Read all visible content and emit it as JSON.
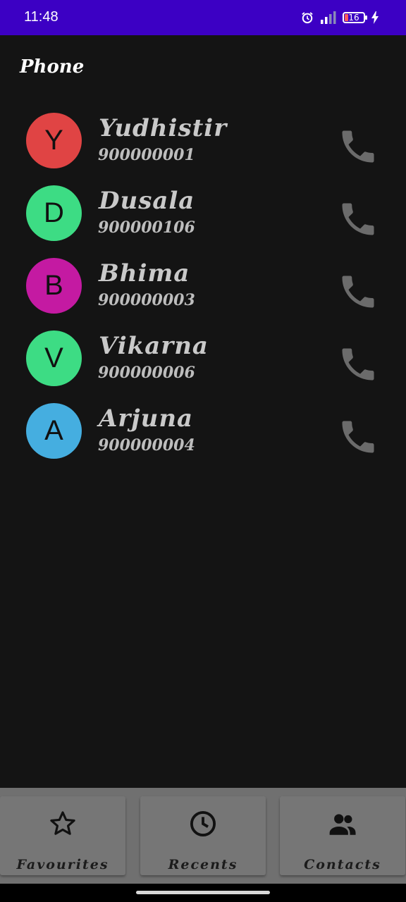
{
  "status_bar": {
    "time": "11:48",
    "battery_level": "16",
    "icons": [
      "alarm-icon",
      "signal-icon",
      "battery-icon",
      "charging-icon"
    ],
    "background_color": "#3c00c4"
  },
  "header": {
    "title": "Phone"
  },
  "contacts": [
    {
      "initial": "Y",
      "name": "Yudhistir",
      "number": "900000001",
      "avatar_color": "#e04444"
    },
    {
      "initial": "D",
      "name": "Dusala",
      "number": "900000106",
      "avatar_color": "#3ddc84"
    },
    {
      "initial": "B",
      "name": "Bhima",
      "number": "900000003",
      "avatar_color": "#c41aa2"
    },
    {
      "initial": "V",
      "name": "Vikarna",
      "number": "900000006",
      "avatar_color": "#3ddc84"
    },
    {
      "initial": "A",
      "name": "Arjuna",
      "number": "900000004",
      "avatar_color": "#45aee0"
    }
  ],
  "bottom_nav": {
    "tabs": [
      {
        "label": "Favourites",
        "icon": "star-icon"
      },
      {
        "label": "Recents",
        "icon": "clock-icon"
      },
      {
        "label": "Contacts",
        "icon": "people-icon"
      }
    ]
  },
  "colors": {
    "background": "#141414",
    "text_primary": "#c9c9c9",
    "call_icon": "#6b6b6b",
    "nav_background": "#767676"
  }
}
